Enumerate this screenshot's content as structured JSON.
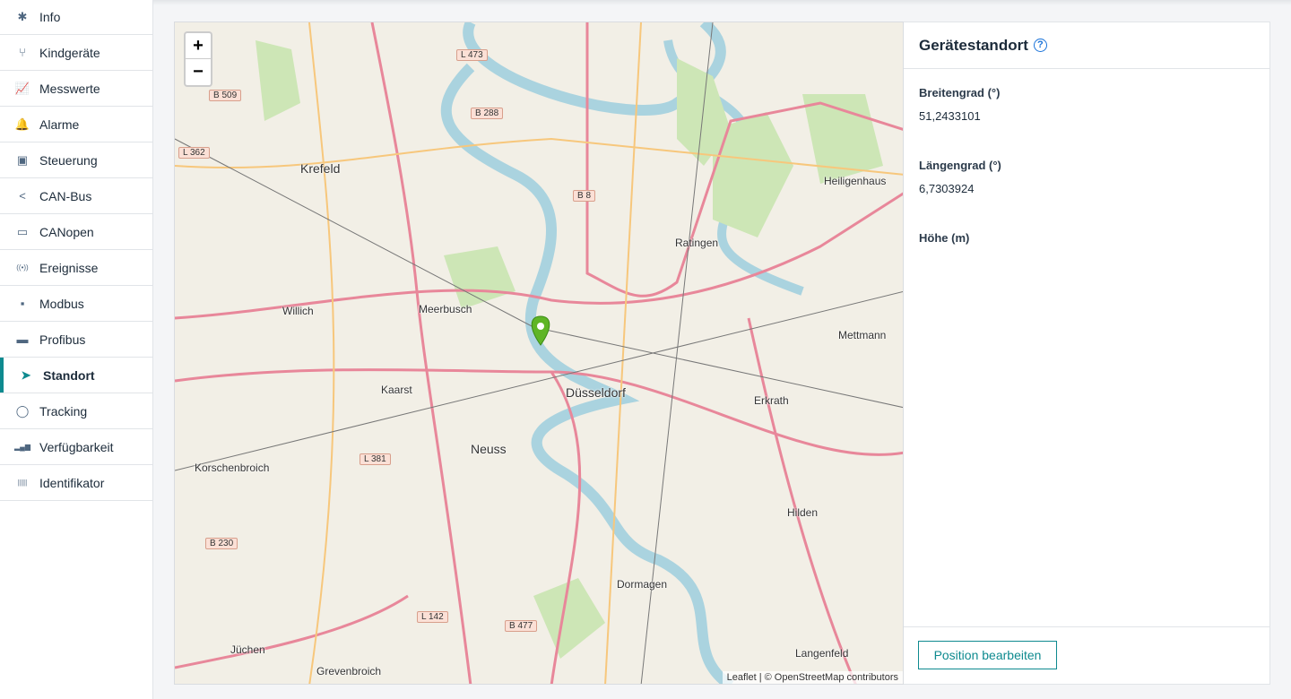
{
  "sidebar": {
    "items": [
      {
        "label": "Info",
        "icon": "info-icon",
        "glyph": "✱"
      },
      {
        "label": "Kindgeräte",
        "icon": "branch-icon",
        "glyph": "⑂"
      },
      {
        "label": "Messwerte",
        "icon": "chart-line-icon",
        "glyph": "📈"
      },
      {
        "label": "Alarme",
        "icon": "bell-icon",
        "glyph": "🔔"
      },
      {
        "label": "Steuerung",
        "icon": "control-icon",
        "glyph": "▣"
      },
      {
        "label": "CAN-Bus",
        "icon": "share-icon",
        "glyph": "<"
      },
      {
        "label": "CANopen",
        "icon": "monitor-icon",
        "glyph": "▭"
      },
      {
        "label": "Ereignisse",
        "icon": "broadcast-icon",
        "glyph": "((•))"
      },
      {
        "label": "Modbus",
        "icon": "chip-icon",
        "glyph": "▪"
      },
      {
        "label": "Profibus",
        "icon": "card-icon",
        "glyph": "▬"
      },
      {
        "label": "Standort",
        "icon": "location-arrow-icon",
        "glyph": "➤",
        "active": true
      },
      {
        "label": "Tracking",
        "icon": "crosshair-icon",
        "glyph": "◯"
      },
      {
        "label": "Verfügbarkeit",
        "icon": "bars-icon",
        "glyph": "▂▄▆"
      },
      {
        "label": "Identifikator",
        "icon": "barcode-icon",
        "glyph": "|||||"
      }
    ]
  },
  "map": {
    "zoom_in": "+",
    "zoom_out": "−",
    "cities": [
      {
        "name": "Krefeld",
        "big": true
      },
      {
        "name": "Düsseldorf",
        "big": true
      },
      {
        "name": "Neuss",
        "big": true
      },
      {
        "name": "Meerbusch"
      },
      {
        "name": "Ratingen"
      },
      {
        "name": "Willich"
      },
      {
        "name": "Kaarst"
      },
      {
        "name": "Erkrath"
      },
      {
        "name": "Mettmann"
      },
      {
        "name": "Hilden"
      },
      {
        "name": "Heiligenhaus"
      },
      {
        "name": "Korschenbroich"
      },
      {
        "name": "Dormagen"
      },
      {
        "name": "Langenfeld"
      },
      {
        "name": "Grevenbroich"
      },
      {
        "name": "Jüchen"
      }
    ],
    "roads": [
      "B 509",
      "L 473",
      "B 288",
      "L 362",
      "B 8",
      "L 381",
      "B 230",
      "L 142",
      "B 477"
    ],
    "attribution": {
      "leaflet": "Leaflet",
      "sep": "| ©",
      "osm": "OpenStreetMap",
      "contrib": "contributors"
    },
    "marker_color": "#5fb526"
  },
  "panel": {
    "title": "Gerätestandort",
    "help": "?",
    "fields": [
      {
        "label": "Breitengrad (°)",
        "value": "51,2433101"
      },
      {
        "label": "Längengrad (°)",
        "value": "6,7303924"
      },
      {
        "label": "Höhe (m)",
        "value": ""
      }
    ],
    "edit_button": "Position bearbeiten"
  }
}
